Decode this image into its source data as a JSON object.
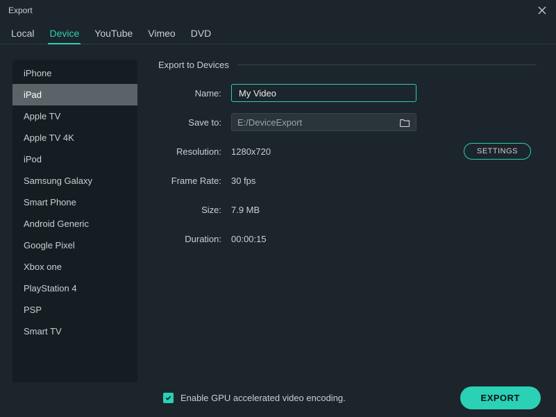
{
  "window": {
    "title": "Export"
  },
  "tabs": [
    {
      "label": "Local"
    },
    {
      "label": "Device"
    },
    {
      "label": "YouTube"
    },
    {
      "label": "Vimeo"
    },
    {
      "label": "DVD"
    }
  ],
  "sidebar": {
    "items": [
      "iPhone",
      "iPad",
      "Apple TV",
      "Apple TV 4K",
      "iPod",
      "Samsung Galaxy",
      "Smart Phone",
      "Android Generic",
      "Google Pixel",
      "Xbox one",
      "PlayStation 4",
      "PSP",
      "Smart TV"
    ],
    "selected_index": 1
  },
  "form": {
    "section_title": "Export to Devices",
    "name_label": "Name:",
    "name_value": "My Video",
    "saveto_label": "Save to:",
    "saveto_value": "E:/DeviceExport",
    "resolution_label": "Resolution:",
    "resolution_value": "1280x720",
    "settings_label": "SETTINGS",
    "framerate_label": "Frame Rate:",
    "framerate_value": "30 fps",
    "size_label": "Size:",
    "size_value": "7.9 MB",
    "duration_label": "Duration:",
    "duration_value": "00:00:15"
  },
  "footer": {
    "gpu_label": "Enable GPU accelerated video encoding.",
    "gpu_checked": true,
    "export_label": "EXPORT"
  },
  "colors": {
    "accent": "#2ad1b4",
    "bg": "#1c252b",
    "panel": "#151d22"
  }
}
